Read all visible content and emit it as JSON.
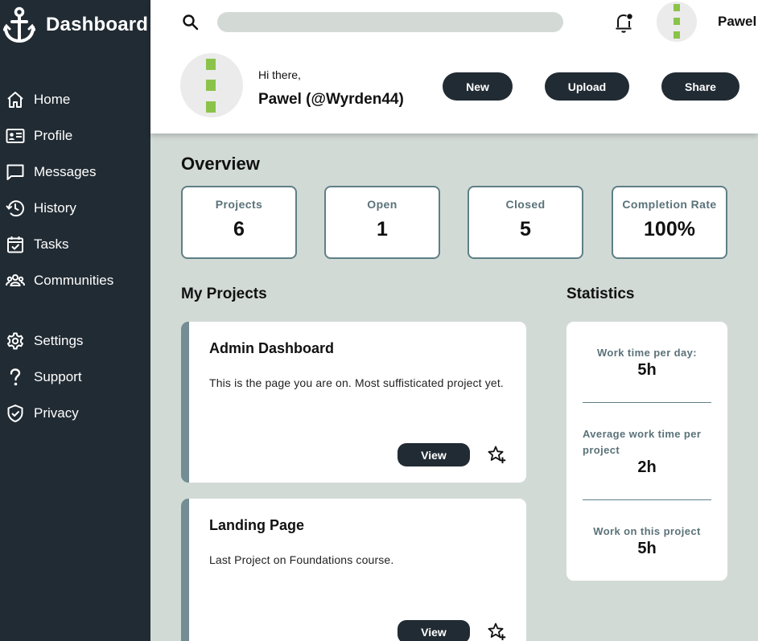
{
  "sidebar": {
    "brand": "Dashboard",
    "items": [
      {
        "label": "Home",
        "icon": "home-icon"
      },
      {
        "label": "Profile",
        "icon": "profile-card-icon"
      },
      {
        "label": "Messages",
        "icon": "message-icon"
      },
      {
        "label": "History",
        "icon": "history-icon"
      },
      {
        "label": "Tasks",
        "icon": "tasks-icon"
      },
      {
        "label": "Communities",
        "icon": "communities-icon"
      },
      {
        "label": "Settings",
        "icon": "gear-icon"
      },
      {
        "label": "Support",
        "icon": "question-icon"
      },
      {
        "label": "Privacy",
        "icon": "shield-icon"
      }
    ]
  },
  "header": {
    "search_placeholder": "",
    "username": "Pawel",
    "greeting": "Hi there,",
    "full_name": "Pawel (@Wyrden44)",
    "buttons": {
      "new": "New",
      "upload": "Upload",
      "share": "Share"
    }
  },
  "overview": {
    "title": "Overview",
    "stats": [
      {
        "label": "Projects",
        "value": "6"
      },
      {
        "label": "Open",
        "value": "1"
      },
      {
        "label": "Closed",
        "value": "5"
      },
      {
        "label": "Completion Rate",
        "value": "100%"
      }
    ]
  },
  "projects": {
    "title": "My Projects",
    "items": [
      {
        "title": "Admin Dashboard",
        "description": "This is the page you are on. Most suffisticated project yet.",
        "view_label": "View"
      },
      {
        "title": "Landing Page",
        "description": "Last Project on Foundations course.",
        "view_label": "View"
      }
    ]
  },
  "statistics": {
    "title": "Statistics",
    "items": [
      {
        "label": "Work time per day:",
        "value": "5h"
      },
      {
        "label": "Average work time per project",
        "value": "2h"
      },
      {
        "label": "Work on this project",
        "value": "5h"
      }
    ]
  },
  "colors": {
    "sidebar_bg": "#212b33",
    "main_bg": "#d2dad6",
    "accent": "#748c93",
    "avatar_green": "#8bc34a"
  }
}
